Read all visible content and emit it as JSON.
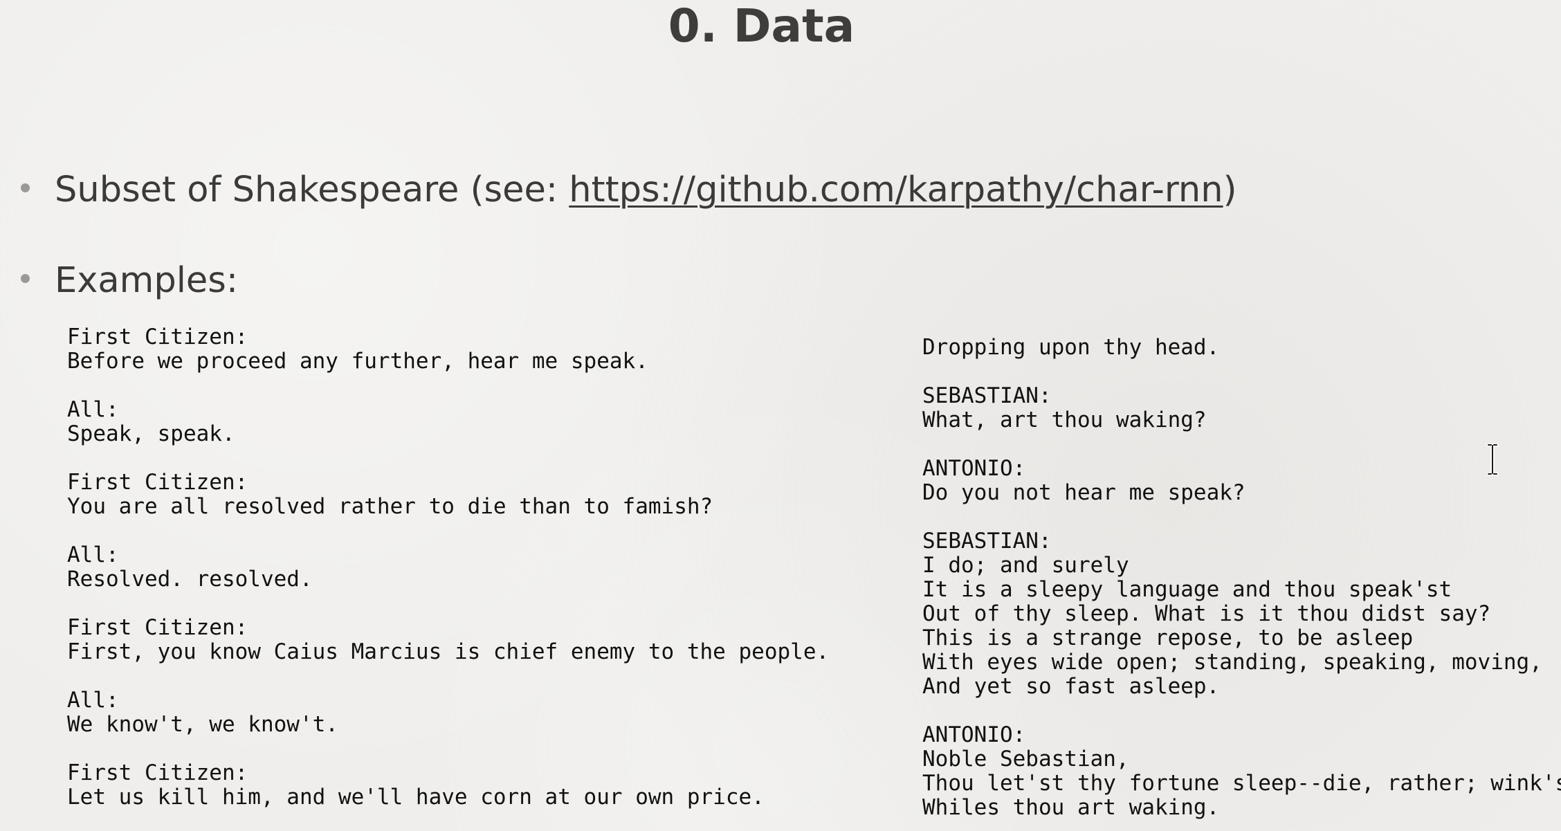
{
  "slide": {
    "title": "0. Data"
  },
  "bullets": [
    {
      "prefix": "Subset of Shakespeare (see: ",
      "link_text": "https://github.com/karpathy/char-rnn",
      "suffix": ")"
    },
    {
      "text": "Examples:"
    }
  ],
  "examples": {
    "left": "First Citizen:\nBefore we proceed any further, hear me speak.\n\nAll:\nSpeak, speak.\n\nFirst Citizen:\nYou are all resolved rather to die than to famish?\n\nAll:\nResolved. resolved.\n\nFirst Citizen:\nFirst, you know Caius Marcius is chief enemy to the people.\n\nAll:\nWe know't, we know't.\n\nFirst Citizen:\nLet us kill him, and we'll have corn at our own price.",
    "right": "Dropping upon thy head.\n\nSEBASTIAN:\nWhat, art thou waking?\n\nANTONIO:\nDo you not hear me speak?\n\nSEBASTIAN:\nI do; and surely\nIt is a sleepy language and thou speak'st\nOut of thy sleep. What is it thou didst say?\nThis is a strange repose, to be asleep\nWith eyes wide open; standing, speaking, moving,\nAnd yet so fast asleep.\n\nANTONIO:\nNoble Sebastian,\nThou let'st thy fortune sleep--die, rather; wink'st\nWhiles thou art waking."
  },
  "icons": {
    "cursor": "text-cursor-icon"
  }
}
